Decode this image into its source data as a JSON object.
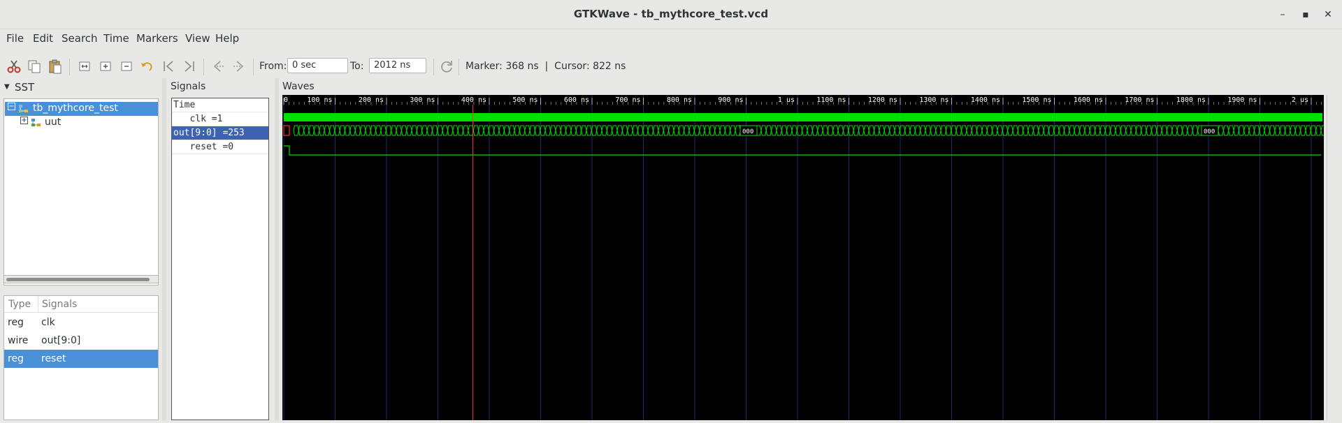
{
  "window": {
    "title": "GTKWave - tb_mythcore_test.vcd",
    "minimize": "–",
    "maximize": "▪",
    "close": "✕"
  },
  "menu": [
    "File",
    "Edit",
    "Search",
    "Time",
    "Markers",
    "View",
    "Help"
  ],
  "toolbar": {
    "from_label": "From:",
    "from_value": "0 sec",
    "to_label": "To:",
    "to_value": "2012 ns",
    "marker": "Marker: 368 ns  |  Cursor: 822 ns"
  },
  "sst": {
    "title": "SST",
    "tree": [
      {
        "label": "tb_mythcore_test",
        "selected": true
      },
      {
        "label": "uut",
        "selected": false
      }
    ],
    "type_header": "Type",
    "signals_header": "Signals",
    "rows": [
      {
        "type": "reg",
        "name": "clk",
        "selected": false
      },
      {
        "type": "wire",
        "name": "out[9:0]",
        "selected": false
      },
      {
        "type": "reg",
        "name": "reset",
        "selected": true
      }
    ]
  },
  "signals": {
    "title": "Signals",
    "header": "Time",
    "rows": [
      {
        "text": "   clk =1",
        "selected": false
      },
      {
        "text": "out[9:0] =253",
        "selected": true
      },
      {
        "text": "   reset =0",
        "selected": false
      }
    ]
  },
  "waves": {
    "title": "Waves",
    "ticks": [
      "0",
      "100 ns",
      "200 ns",
      "300 ns",
      "400 ns",
      "500 ns",
      "600 ns",
      "700 ns",
      "800 ns",
      "900 ns",
      "1 us",
      "1100 ns",
      "1200 ns",
      "1300 ns",
      "1400 ns",
      "1500 ns",
      "1600 ns",
      "1700 ns",
      "1800 ns",
      "1900 ns",
      "2 us"
    ],
    "marker_ns": 368,
    "range_ns": 2012,
    "bus_labels": [
      "000",
      "000"
    ],
    "colors": {
      "wave": "#00e000",
      "grid": "#1e2a6e",
      "marker": "#ff3030",
      "bg": "#000000"
    }
  }
}
